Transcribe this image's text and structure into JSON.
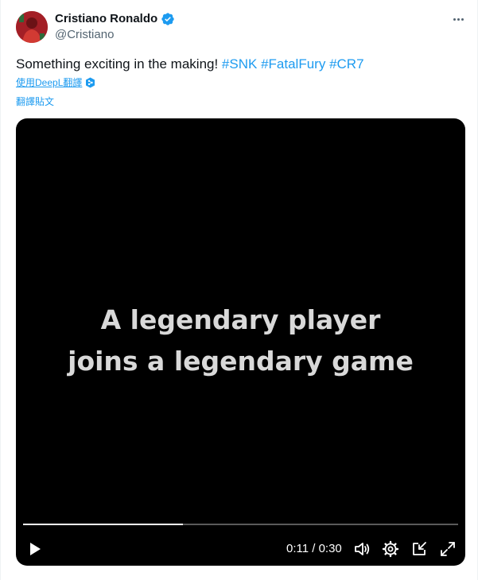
{
  "author": {
    "name": "Cristiano Ronaldo",
    "handle": "@Cristiano",
    "verified_color": "#1d9bf0"
  },
  "tweet": {
    "text_plain": "Something exciting in the making! ",
    "hashtags": [
      "#SNK",
      "#FatalFury",
      "#CR7"
    ],
    "translate_deepl": "使用DeepL翻譯",
    "translate_post": "翻譯貼文"
  },
  "video": {
    "line1": "A legendary player",
    "line2": "joins a legendary game",
    "time": "0:11 / 0:30",
    "progress_fraction": 0.3667
  },
  "icons": {
    "more": "more-icon",
    "play": "play-icon",
    "volume": "volume-icon",
    "settings": "settings-icon",
    "dock": "dock-icon",
    "fullscreen": "fullscreen-icon"
  },
  "colors": {
    "link": "#1d9bf0",
    "text": "#0f1419",
    "muted": "#536471",
    "video_bg": "#000000"
  }
}
